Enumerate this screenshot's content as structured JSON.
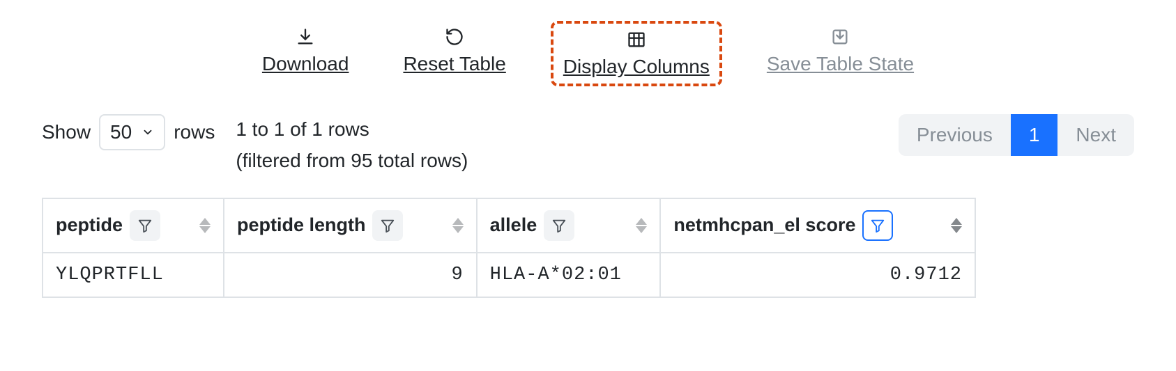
{
  "toolbar": {
    "download": "Download",
    "reset": "Reset Table",
    "display_columns": "Display Columns",
    "save_state": "Save Table State"
  },
  "show_rows": {
    "prefix": "Show",
    "value": "50",
    "suffix": "rows"
  },
  "info": {
    "range": "1 to 1 of 1 rows",
    "filtered": "(filtered from 95 total rows)"
  },
  "pagination": {
    "prev": "Previous",
    "page": "1",
    "next": "Next"
  },
  "columns": {
    "peptide": "peptide",
    "peptide_length": "peptide length",
    "allele": "allele",
    "score": "netmhcpan_el score"
  },
  "rows": [
    {
      "peptide": "YLQPRTFLL",
      "peptide_length": "9",
      "allele": "HLA-A*02:01",
      "score": "0.9712"
    }
  ]
}
